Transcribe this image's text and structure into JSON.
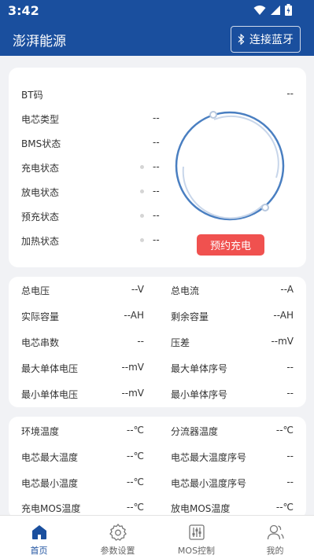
{
  "status_bar": {
    "time": "3:42"
  },
  "app": {
    "title": "澎湃能源",
    "connect_label": "连接蓝牙"
  },
  "battery_info": {
    "rows": [
      {
        "label": "BT码",
        "value": "--"
      },
      {
        "label": "电芯类型",
        "value": "--"
      },
      {
        "label": "BMS状态",
        "value": "--"
      },
      {
        "label": "充电状态",
        "value": "--"
      },
      {
        "label": "放电状态",
        "value": "--"
      },
      {
        "label": "预充状态",
        "value": "--"
      },
      {
        "label": "加热状态",
        "value": "--"
      }
    ],
    "charge_button": "预约充电"
  },
  "electrical": {
    "rows": [
      {
        "left_label": "总电压",
        "left_value": "--V",
        "right_label": "总电流",
        "right_value": "--A"
      },
      {
        "left_label": "实际容量",
        "left_value": "--AH",
        "right_label": "剩余容量",
        "right_value": "--AH"
      },
      {
        "left_label": "电芯串数",
        "left_value": "--",
        "right_label": "压差",
        "right_value": "--mV"
      },
      {
        "left_label": "最大单体电压",
        "left_value": "--mV",
        "right_label": "最大单体序号",
        "right_value": "--"
      },
      {
        "left_label": "最小单体电压",
        "left_value": "--mV",
        "right_label": "最小单体序号",
        "right_value": "--"
      }
    ]
  },
  "temperature": {
    "rows": [
      {
        "left_label": "环境温度",
        "left_value": "--℃",
        "right_label": "分流器温度",
        "right_value": "--℃"
      },
      {
        "left_label": "电芯最大温度",
        "left_value": "--℃",
        "right_label": "电芯最大温度序号",
        "right_value": "--"
      },
      {
        "left_label": "电芯最小温度",
        "left_value": "--℃",
        "right_label": "电芯最小温度序号",
        "right_value": "--"
      },
      {
        "left_label": "充电MOS温度",
        "left_value": "--℃",
        "right_label": "放电MOS温度",
        "right_value": "--℃"
      }
    ]
  },
  "nav": {
    "items": [
      {
        "label": "首页",
        "icon": "home-icon"
      },
      {
        "label": "参数设置",
        "icon": "gear-icon"
      },
      {
        "label": "MOS控制",
        "icon": "sliders-icon"
      },
      {
        "label": "我的",
        "icon": "user-icon"
      }
    ]
  },
  "colors": {
    "primary": "#1a4f9e",
    "accent": "#f0514f",
    "ring": "#4a7fc1"
  }
}
